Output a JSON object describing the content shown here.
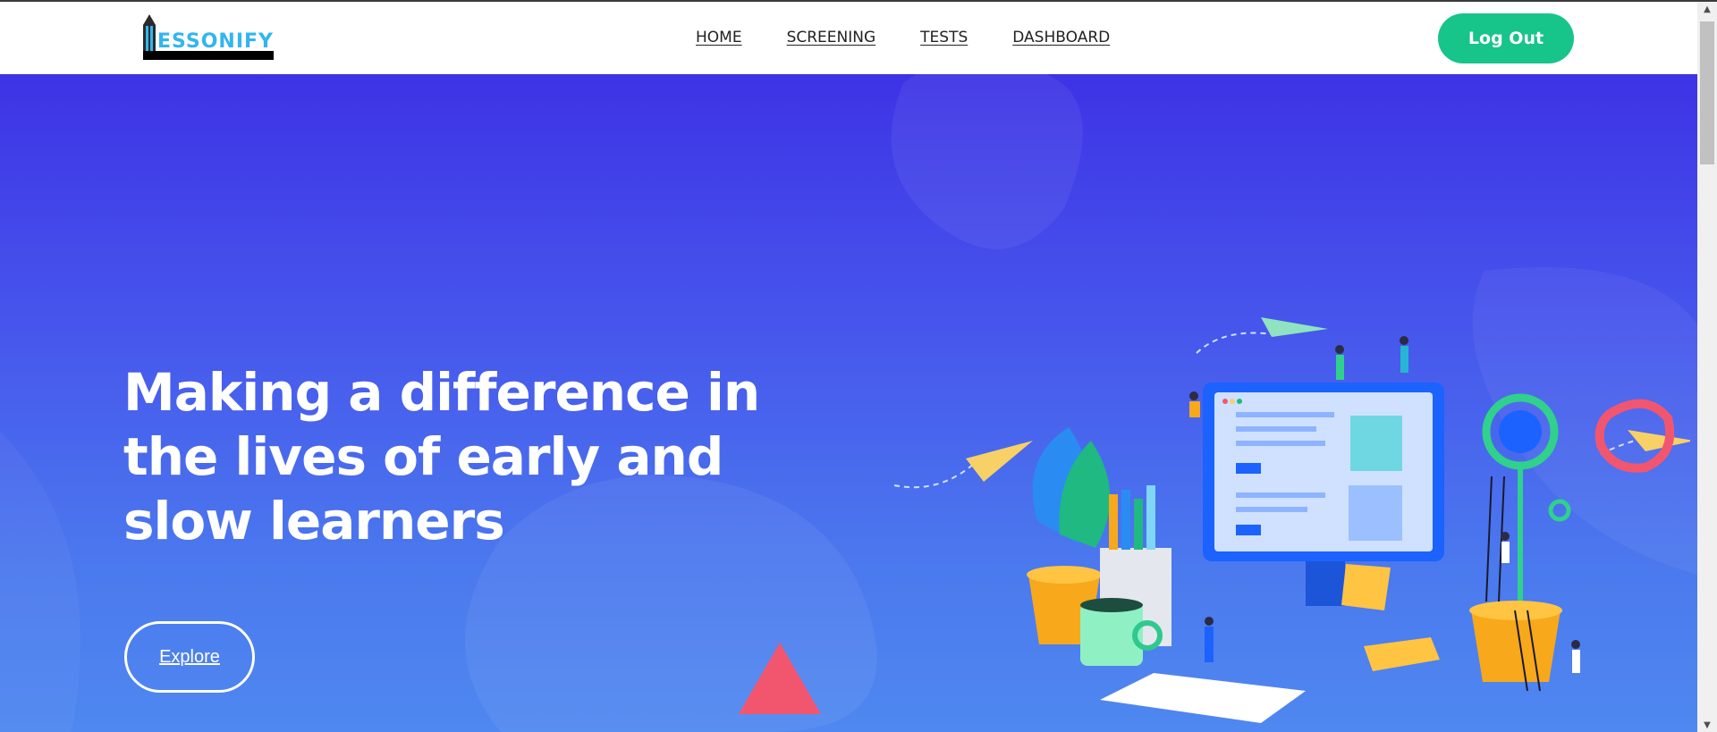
{
  "brand": {
    "logo_text": "ESSONIFY",
    "accent_color": "#33b5f0"
  },
  "nav": {
    "items": [
      {
        "label": "HOME"
      },
      {
        "label": "SCREENING"
      },
      {
        "label": "TESTS"
      },
      {
        "label": "DASHBOARD"
      }
    ],
    "logout_label": "Log Out",
    "logout_color": "#17c489"
  },
  "hero": {
    "title": "Making a difference in the lives of early and slow learners",
    "cta_label": "Explore",
    "gradient_top": "#3d33e5",
    "gradient_bottom": "#4f88f0"
  },
  "scrollbar": {
    "up_icon": "triangle-up-icon",
    "down_icon": "triangle-down-icon"
  }
}
